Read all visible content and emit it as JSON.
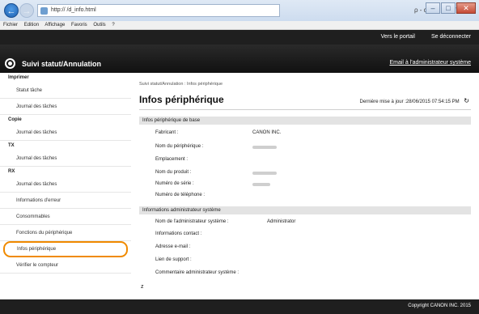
{
  "browser": {
    "address": "http://                        /d_info.html",
    "tools": "ρ - c",
    "menu": [
      "Fichier",
      "Edition",
      "Affichage",
      "Favoris",
      "Outils",
      "?"
    ]
  },
  "header": {
    "portal_link": "Vers le portail",
    "logout_link": "Se déconnecter",
    "title": "Suivi statut/Annulation",
    "mail_link": "Email à l'administrateur système"
  },
  "sidebar": {
    "sections": [
      {
        "label": "Imprimer",
        "items": [
          "Statut tâche",
          "Journal des tâches"
        ]
      },
      {
        "label": "Copie",
        "items": [
          "Journal des tâches"
        ]
      },
      {
        "label": "TX",
        "items": [
          "Journal des tâches"
        ]
      },
      {
        "label": "RX",
        "items": [
          "Journal des tâches",
          "Informations d'erreur",
          "Consommables",
          "Fonctions du périphérique",
          "Infos périphérique",
          "Vérifier le compteur"
        ]
      }
    ]
  },
  "main": {
    "breadcrumb": "Suivi statut/Annulation : Infos périphérique",
    "title": "Infos périphérique",
    "last_update": "Dernière mise à jour :28/06/2015 07:54:15 PM",
    "basic_header": "Infos périphérique de base",
    "basic_rows": [
      {
        "label": "Fabricant :",
        "value": "CANON INC."
      },
      {
        "label": "Nom du périphérique :",
        "value": ""
      },
      {
        "label": "Emplacement :",
        "value": ""
      },
      {
        "label": "Nom du produit :",
        "value": ""
      },
      {
        "label": "Numéro de série :",
        "value": ""
      },
      {
        "label": "Numéro de téléphone :",
        "value": ""
      }
    ],
    "admin_header": "Informations administrateur système",
    "admin_rows": [
      {
        "label": "Nom de l'administrateur système :",
        "value": "Administrator"
      },
      {
        "label": "Informations contact :",
        "value": ""
      },
      {
        "label": "Adresse e-mail :",
        "value": ""
      },
      {
        "label": "Lien de support :",
        "value": ""
      },
      {
        "label": "Commentaire administrateur système :",
        "value": ""
      }
    ],
    "scroll_mark": "z"
  },
  "footer": {
    "copyright": "Copyright CANON INC. 2015"
  },
  "colors": {
    "highlight": "#f08a00",
    "header_bg": "#1f1f1f"
  }
}
